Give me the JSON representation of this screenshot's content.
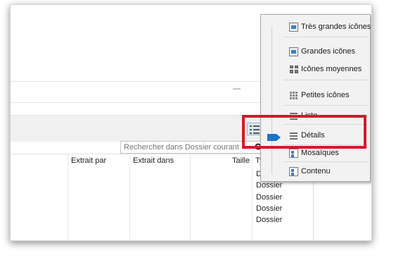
{
  "window": {
    "minimize_glyph": "—",
    "search": {
      "placeholder": "Rechercher dans Dossier courant",
      "value": ""
    }
  },
  "columns": [
    {
      "label": "Extrait par"
    },
    {
      "label": "Extrait dans"
    },
    {
      "label": "Taille"
    },
    {
      "label": "Ty"
    }
  ],
  "type_values": [
    "D",
    "Dossier",
    "Dossier",
    "Dossier",
    "Dossier"
  ],
  "view_menu": {
    "items": [
      {
        "label": "Très grandes icônes",
        "icon": "extra-large-icons-icon"
      },
      {
        "label": "Grandes icônes",
        "icon": "large-icons-icon"
      },
      {
        "label": "Icônes moyennes",
        "icon": "medium-icons-icon"
      },
      {
        "label": "Petites icônes",
        "icon": "small-icons-icon"
      },
      {
        "label": "Liste",
        "icon": "list-icon"
      },
      {
        "label": "Détails",
        "icon": "details-icon",
        "selected": true
      },
      {
        "label": "Mosaïques",
        "icon": "tiles-icon"
      },
      {
        "label": "Contenu",
        "icon": "content-icon"
      }
    ]
  },
  "colors": {
    "highlight_border": "#d6182a",
    "slider_thumb": "#1e74c9",
    "menu_background": "#f2f2f2"
  }
}
